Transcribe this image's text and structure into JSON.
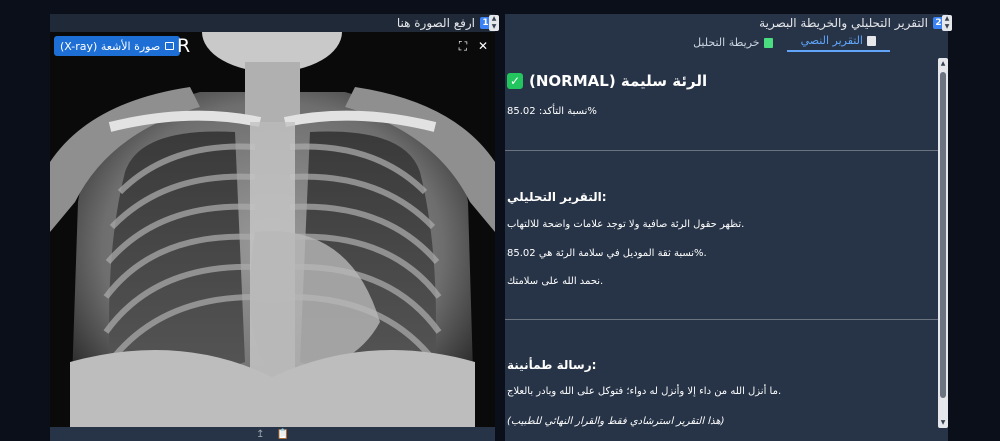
{
  "left_panel": {
    "number": "1",
    "title": "ارفع الصورة هنا",
    "image_label": "صورة الأشعة (X-ray)",
    "orientation_marker": "R",
    "tools": {
      "fullscreen_symbol": "⛶",
      "close_symbol": "✕"
    },
    "bottom_icons": [
      "↥",
      "📋"
    ]
  },
  "right_panel": {
    "number": "2",
    "title": "التقرير التحليلي والخريطة البصرية",
    "tabs": [
      {
        "label": "التقرير النصي",
        "icon": "document-icon",
        "active": true
      },
      {
        "label": "خريطة التحليل",
        "icon": "chart-image-icon",
        "active": false
      }
    ],
    "report": {
      "status": "الرئة سليمة (NORMAL)",
      "confidence_line": "%نسبة التأكد: 85.02",
      "analysis_heading": ":التقرير التحليلي",
      "analysis_text": ".تظهر حقول الرئة صافية ولا توجد علامات واضحة للالتهاب",
      "model_confidence": ".%نسبة ثقة الموديل في سلامة الرئة هي 85.02",
      "praise": ".نحمد الله على سلامتك",
      "reassurance_heading": ":رسالة طمأنينة",
      "hadith": ".ما أنزل الله من داء إلا وأنزل له دواء؛ فتوكل على الله وبادر بالعلاج",
      "disclaimer": "(هذا التقرير استرشادي فقط والقرار النهائي للطبيب)"
    }
  },
  "colors": {
    "background": "#0b0f19",
    "panel": "#273447",
    "accent": "#3b82f6",
    "success": "#22c55e"
  }
}
